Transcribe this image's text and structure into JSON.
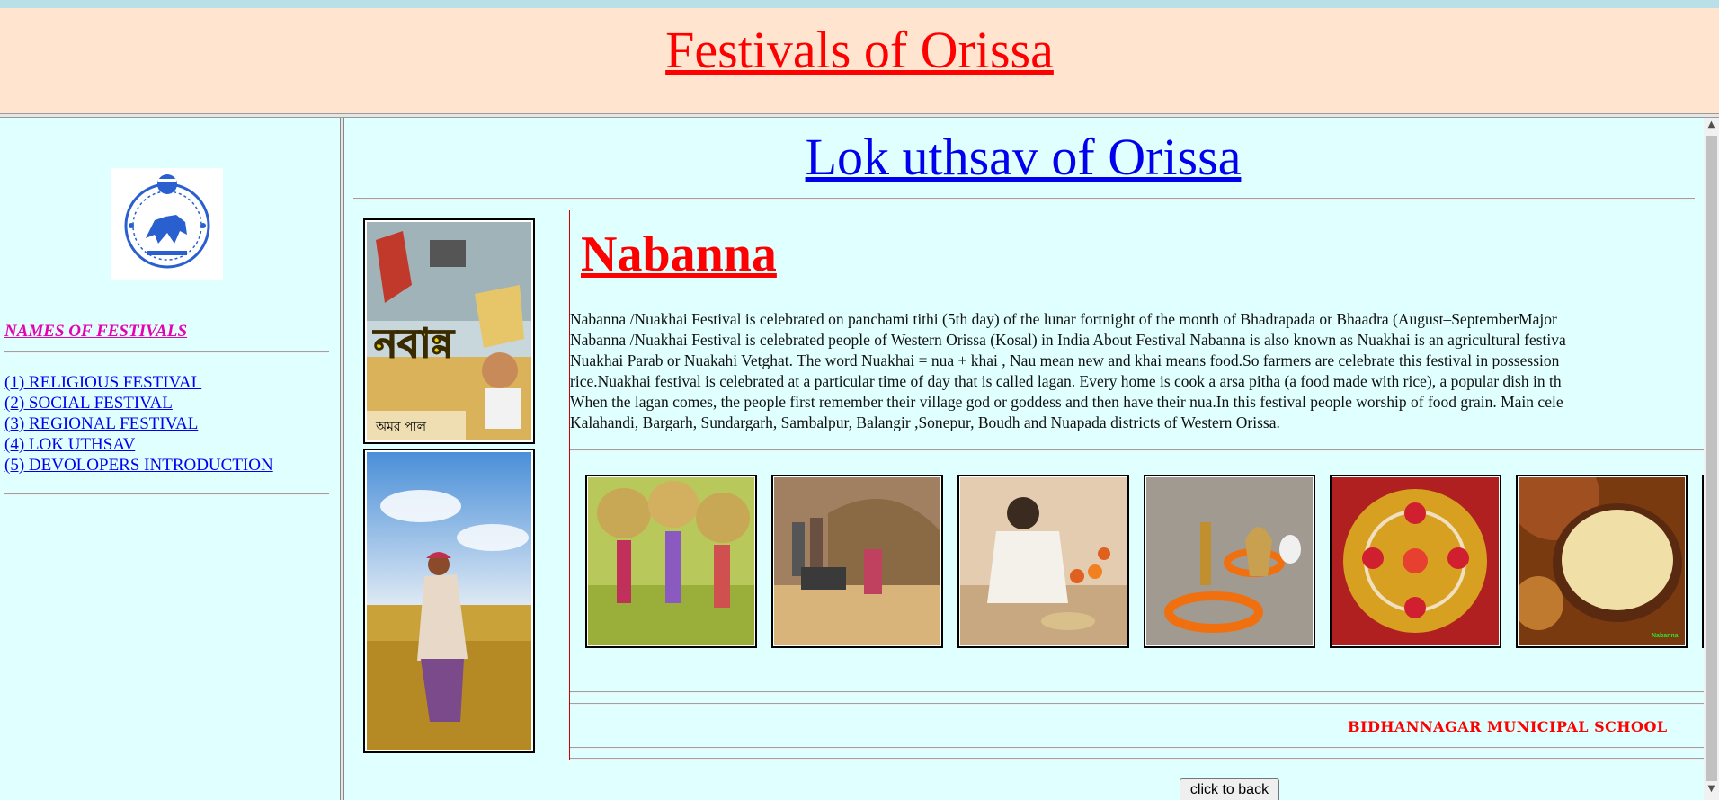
{
  "header": {
    "title": "Festivals of Orissa"
  },
  "sidebar": {
    "emblem": "state-emblem",
    "heading": "NAMES OF FESTIVALS",
    "links": [
      {
        "label": "(1) RELIGIOUS FESTIVAL"
      },
      {
        "label": "(2) SOCIAL FESTIVAL"
      },
      {
        "label": "(3) REGIONAL FESTIVAL"
      },
      {
        "label": "(4) LOK UTHSAV"
      },
      {
        "label": "(5) DEVOLOPERS INTRODUCTION"
      }
    ]
  },
  "main": {
    "title": "Lok uthsav of Orissa",
    "festival_title": "Nabanna",
    "poster_text": "নবান্ন",
    "poster_caption": "অমর পাল",
    "description_lines": [
      "Nabanna /Nuakhai Festival is celebrated on panchami tithi (5th day) of the lunar fortnight of the month of Bhadrapada or Bhaadra (August–SeptemberMajor",
      "Nabanna /Nuakhai Festival is celebrated people of Western Orissa (Kosal) in India About Festival Nabanna is also known as Nuakhai is an agricultural festiva",
      "Nuakhai Parab or Nuakahi Vetghat. The word Nuakhai = nua + khai , Nau mean new and khai means food.So farmers are celebrate this festival in possession",
      "rice.Nuakhai festival is celebrated at a particular time of day that is called lagan. Every home is cook a arsa pitha (a food made with rice), a popular dish in th",
      "When the lagan comes, the people first remember their village god or goddess and then have their nua.In this festival people worship of food grain. Main cele",
      "Kalahandi, Bargarh, Sundargarh, Sambalpur, Balangir ,Sonepur, Boudh and Nuapada districts of Western Orissa."
    ],
    "gallery_last_caption": "Nabanna",
    "school": "BIDHANNAGAR MUNICIPAL SCHOOL",
    "back_button": "click to back"
  },
  "colors": {
    "header_bg": "#ffe4cf",
    "page_bg": "#e0ffff",
    "title_red": "#ff0000",
    "link_blue": "#0000ee",
    "heading_magenta": "#e600b0"
  }
}
